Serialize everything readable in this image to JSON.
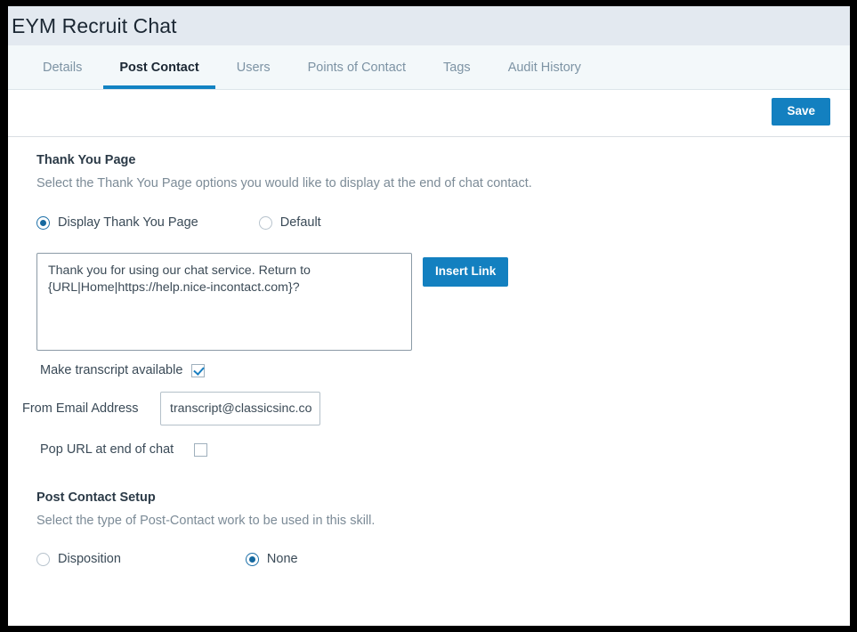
{
  "header": {
    "title": "EYM Recruit Chat"
  },
  "tabs": [
    {
      "label": "Details",
      "active": false
    },
    {
      "label": "Post Contact",
      "active": true
    },
    {
      "label": "Users",
      "active": false
    },
    {
      "label": "Points of Contact",
      "active": false
    },
    {
      "label": "Tags",
      "active": false
    },
    {
      "label": "Audit History",
      "active": false
    }
  ],
  "toolbar": {
    "save_label": "Save"
  },
  "thank_you_page": {
    "title": "Thank You Page",
    "description": "Select the Thank You Page options you would like to display at the end of chat contact.",
    "options": [
      {
        "label": "Display Thank You Page",
        "selected": true
      },
      {
        "label": "Default",
        "selected": false
      }
    ],
    "message_text": "Thank you for using our chat service. Return to {URL|Home|https://help.nice-incontact.com}?",
    "insert_link_label": "Insert Link",
    "make_transcript_label": "Make transcript available",
    "make_transcript_checked": true,
    "from_email_label": "From Email Address",
    "from_email_value": "transcript@classicsinc.com",
    "pop_url_label": "Pop URL at end of chat",
    "pop_url_checked": false
  },
  "post_contact_setup": {
    "title": "Post Contact Setup",
    "description": "Select the type of Post-Contact work to be used in this skill.",
    "options": [
      {
        "label": "Disposition",
        "selected": false
      },
      {
        "label": "None",
        "selected": true
      }
    ]
  },
  "colors": {
    "accent_blue": "#1380c0",
    "header_band": "#e3e9f0",
    "tabbar": "#f3f8fa",
    "radio_fill": "#15689f"
  }
}
